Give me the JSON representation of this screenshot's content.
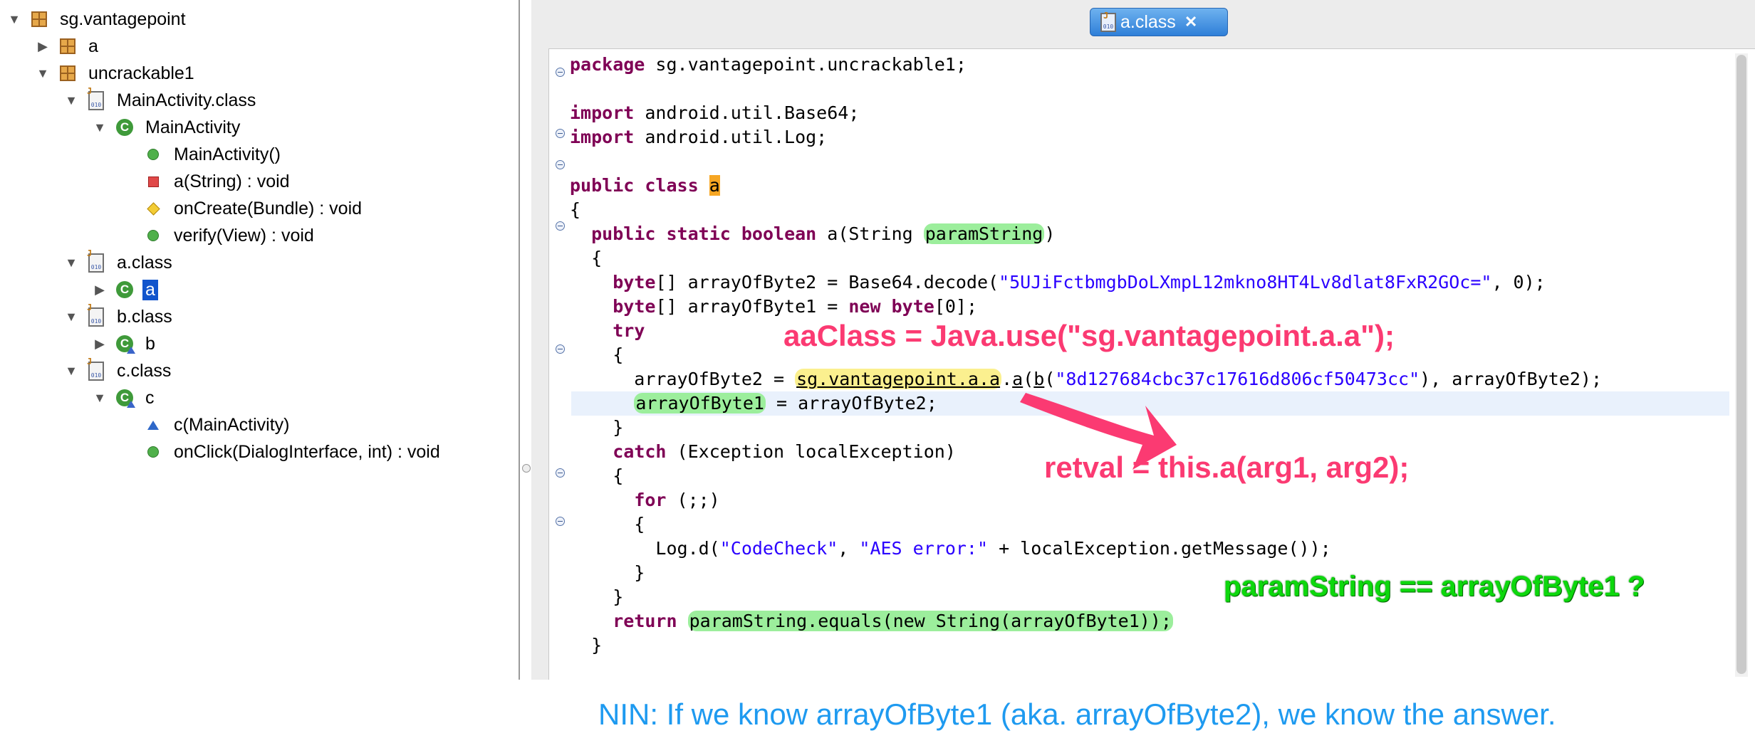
{
  "tree": [
    {
      "label": "sg.vantagepoint",
      "twisty": "open",
      "icon": "package",
      "indent": 0
    },
    {
      "label": "a",
      "twisty": "closed",
      "icon": "package",
      "indent": 1
    },
    {
      "label": "uncrackable1",
      "twisty": "open",
      "icon": "package",
      "indent": 1
    },
    {
      "label": "MainActivity.class",
      "twisty": "open",
      "icon": "class-file",
      "indent": 2
    },
    {
      "label": "MainActivity",
      "twisty": "open",
      "icon": "class",
      "indent": 3
    },
    {
      "label": "MainActivity()",
      "twisty": "none",
      "icon": "method-public",
      "indent": 4
    },
    {
      "label": "a(String) : void",
      "twisty": "none",
      "icon": "method-private",
      "indent": 4
    },
    {
      "label": "onCreate(Bundle) : void",
      "twisty": "none",
      "icon": "method-protected",
      "indent": 4
    },
    {
      "label": "verify(View) : void",
      "twisty": "none",
      "icon": "method-public",
      "indent": 4
    },
    {
      "label": "a.class",
      "twisty": "open",
      "icon": "class-file",
      "indent": 2
    },
    {
      "label": "a",
      "twisty": "closed",
      "icon": "class",
      "indent": 3,
      "selected": true
    },
    {
      "label": "b.class",
      "twisty": "open",
      "icon": "class-file",
      "indent": 2
    },
    {
      "label": "b",
      "twisty": "closed",
      "icon": "class-default",
      "indent": 3
    },
    {
      "label": "c.class",
      "twisty": "open",
      "icon": "class-file",
      "indent": 2
    },
    {
      "label": "c",
      "twisty": "open",
      "icon": "class-default",
      "indent": 3
    },
    {
      "label": "c(MainActivity)",
      "twisty": "none",
      "icon": "method-default",
      "indent": 4
    },
    {
      "label": "onClick(DialogInterface, int) : void",
      "twisty": "none",
      "icon": "method-public",
      "indent": 4
    }
  ],
  "tab": {
    "label": "a.class",
    "close_glyph": "✕",
    "file_icon_text": "010"
  },
  "code": [
    [
      [
        "kw",
        "package"
      ],
      [
        "t",
        " sg.vantagepoint.uncrackable1;"
      ]
    ],
    [],
    [
      [
        "kw",
        "import"
      ],
      [
        "t",
        " android.util.Base64;"
      ]
    ],
    [
      [
        "kw",
        "import"
      ],
      [
        "t",
        " android.util.Log;"
      ]
    ],
    [],
    [
      [
        "kw",
        "public"
      ],
      [
        "t",
        " "
      ],
      [
        "kw",
        "class"
      ],
      [
        "t",
        " "
      ],
      [
        "ohl",
        "a"
      ]
    ],
    [
      [
        "t",
        "{"
      ]
    ],
    [
      [
        "t",
        "  "
      ],
      [
        "kw",
        "public"
      ],
      [
        "t",
        " "
      ],
      [
        "kw",
        "static"
      ],
      [
        "t",
        " "
      ],
      [
        "kw",
        "boolean"
      ],
      [
        "t",
        " a(String "
      ],
      [
        "ghl",
        "paramString"
      ],
      [
        "t",
        ")"
      ]
    ],
    [
      [
        "t",
        "  {"
      ]
    ],
    [
      [
        "t",
        "    "
      ],
      [
        "kw",
        "byte"
      ],
      [
        "t",
        "[] arrayOfByte2 = Base64.decode("
      ],
      [
        "str",
        "\"5UJiFctbmgbDoLXmpL12mkno8HT4Lv8dlat8FxR2GOc=\""
      ],
      [
        "t",
        ", 0);"
      ]
    ],
    [
      [
        "t",
        "    "
      ],
      [
        "kw",
        "byte"
      ],
      [
        "t",
        "[] arrayOfByte1 = "
      ],
      [
        "kw",
        "new"
      ],
      [
        "t",
        " "
      ],
      [
        "kw",
        "byte"
      ],
      [
        "t",
        "[0];"
      ]
    ],
    [
      [
        "t",
        "    "
      ],
      [
        "kw",
        "try"
      ]
    ],
    [
      [
        "t",
        "    {"
      ]
    ],
    [
      [
        "t",
        "      arrayOfByte2 = "
      ],
      [
        "yhl",
        "sg.vantagepoint.a.a"
      ],
      [
        "t",
        "."
      ],
      [
        "ul",
        "a"
      ],
      [
        "t",
        "("
      ],
      [
        "ul",
        "b"
      ],
      [
        "t",
        "("
      ],
      [
        "str",
        "\"8d127684cbc37c17616d806cf50473cc\""
      ],
      [
        "t",
        "), arrayOfByte2);"
      ]
    ],
    [
      [
        "t",
        "      "
      ],
      [
        "ghl",
        "arrayOfByte1"
      ],
      [
        "t",
        " = arrayOfByte2;"
      ]
    ],
    [
      [
        "t",
        "    }"
      ]
    ],
    [
      [
        "t",
        "    "
      ],
      [
        "kw",
        "catch"
      ],
      [
        "t",
        " (Exception localException)"
      ]
    ],
    [
      [
        "t",
        "    {"
      ]
    ],
    [
      [
        "t",
        "      "
      ],
      [
        "kw",
        "for"
      ],
      [
        "t",
        " (;;)"
      ]
    ],
    [
      [
        "t",
        "      {"
      ]
    ],
    [
      [
        "t",
        "        Log.d("
      ],
      [
        "str",
        "\"CodeCheck\""
      ],
      [
        "t",
        ", "
      ],
      [
        "str",
        "\"AES error:\""
      ],
      [
        "t",
        " + localException.getMessage());"
      ]
    ],
    [
      [
        "t",
        "      }"
      ]
    ],
    [
      [
        "t",
        "    }"
      ]
    ],
    [
      [
        "t",
        "    "
      ],
      [
        "kw",
        "return"
      ],
      [
        "t",
        " "
      ],
      [
        "ghl",
        "paramString.equals(new String(arrayOfByte1));"
      ]
    ],
    [
      [
        "t",
        "  }"
      ]
    ]
  ],
  "annotations": {
    "aaclass": "aaClass = Java.use(\"sg.vantagepoint.a.a\");",
    "retval": "retval = this.a(arg1, arg2);",
    "param": "paramString == arrayOfByte1 ?",
    "nin": "NIN: If we know arrayOfByte1 (aka. arrayOfByte2), we know the answer."
  },
  "colors": {
    "keyword": "#7f0055",
    "string": "#2a00ff",
    "green_highlight": "#9cee9c",
    "yellow_highlight": "#fbf08f",
    "orange_highlight": "#f6a623",
    "annotation_pink": "#fb3a72",
    "annotation_green": "#0dd80d",
    "annotation_blue": "#1e9af0",
    "tab_blue": "#2f7fd8",
    "selection_blue": "#1255cc"
  }
}
